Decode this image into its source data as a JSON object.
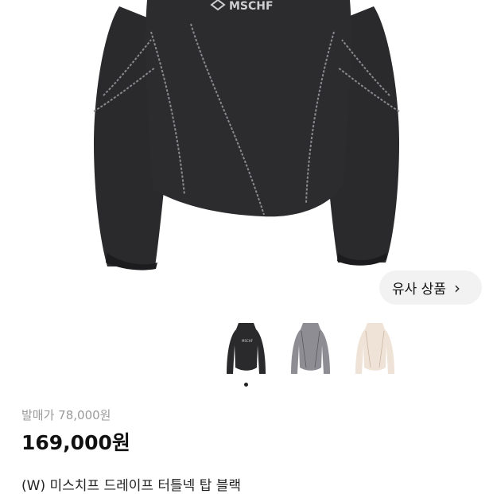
{
  "product": {
    "image_logo_text": "MSCHF",
    "similar_label": "유사 상품",
    "similar_chevron": "›",
    "thumbnails": [
      {
        "color": "#2a2a2c"
      },
      {
        "color": "#8e8d93"
      },
      {
        "color": "#efe3d7"
      }
    ],
    "selected_thumbnail": 1,
    "original_price_label": "발매가 78,000원",
    "price": "169,000원",
    "title": "(W) 미스치프 드레이프 터틀넥 탑 블랙"
  }
}
